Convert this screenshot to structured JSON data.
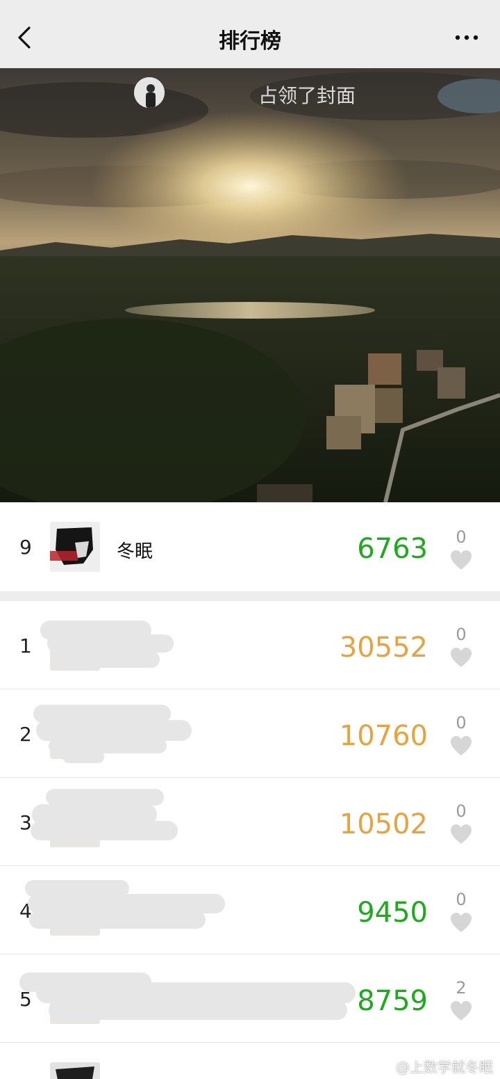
{
  "header": {
    "title": "排行榜",
    "back_icon": "chevron-left-icon",
    "more_icon": "more-dots-icon"
  },
  "cover": {
    "caption": "占领了封面"
  },
  "my_entry": {
    "rank": "9",
    "name": "冬眠",
    "steps": "6763",
    "likes": "0"
  },
  "ranking": [
    {
      "rank": "1",
      "name": "",
      "steps": "30552",
      "likes": "0",
      "color": "#e8a33d"
    },
    {
      "rank": "2",
      "name": "",
      "steps": "10760",
      "likes": "0",
      "color": "#e8a33d"
    },
    {
      "rank": "3",
      "name": "",
      "steps": "10502",
      "likes": "0",
      "color": "#e8a33d"
    },
    {
      "rank": "4",
      "name": "",
      "steps": "9450",
      "likes": "0",
      "color": "#1aad19"
    },
    {
      "rank": "5",
      "name": "",
      "steps": "8759",
      "likes": "2",
      "color": "#1aad19"
    }
  ],
  "colors": {
    "top3_steps": "#e8a33d",
    "steps": "#1aad19",
    "background": "#ededed"
  },
  "watermark": "@上数学就冬眠"
}
